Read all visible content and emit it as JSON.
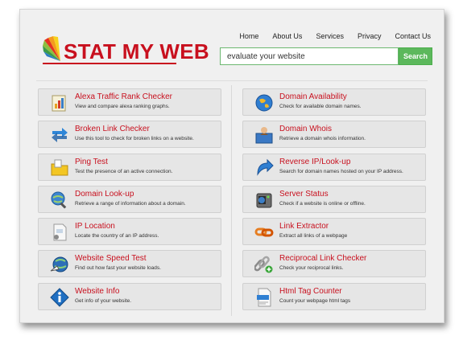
{
  "brand": {
    "name": "STAT MY WEB",
    "accent": "#c8101e"
  },
  "nav": [
    "Home",
    "About Us",
    "Services",
    "Privacy",
    "Contact Us"
  ],
  "search": {
    "value": "evaluate your website",
    "button": "Search",
    "button_color": "#5cb85c"
  },
  "tools_left": [
    {
      "title": "Alexa Traffic Rank Checker",
      "desc": "View and compare alexa ranking graphs.",
      "icon": "ranking-chart-icon"
    },
    {
      "title": "Broken Link Checker",
      "desc": "Use this tool to check for broken links on a website.",
      "icon": "broken-link-arrow-icon"
    },
    {
      "title": "Ping Test",
      "desc": "Test the presence of an active connection.",
      "icon": "folder-ping-icon"
    },
    {
      "title": "Domain Look-up",
      "desc": "Retrieve a range of information about a domain.",
      "icon": "globe-search-icon"
    },
    {
      "title": "IP Location",
      "desc": "Locate the country of an IP address.",
      "icon": "ip-document-icon"
    },
    {
      "title": "Website Speed Test",
      "desc": "Find out how fast your website loads.",
      "icon": "speed-globe-icon"
    },
    {
      "title": "Website Info",
      "desc": "Get info of your website.",
      "icon": "info-icon"
    }
  ],
  "tools_right": [
    {
      "title": "Domain Availability",
      "desc": "Check for available domain names.",
      "icon": "globe-icon"
    },
    {
      "title": "Domain Whois",
      "desc": "Retrieve a domain whois information.",
      "icon": "whois-person-icon"
    },
    {
      "title": "Reverse IP/Look-up",
      "desc": "Search for domain names hosted on your IP address.",
      "icon": "reverse-arrow-icon"
    },
    {
      "title": "Server Status",
      "desc": "Check if a website is online or offline.",
      "icon": "server-icon"
    },
    {
      "title": "Link Extractor",
      "desc": "Extract all links of a webpage",
      "icon": "chain-link-icon"
    },
    {
      "title": "Reciprocal Link Checker",
      "desc": "Check your reciprocal links.",
      "icon": "link-add-icon"
    },
    {
      "title": "Html Tag Counter",
      "desc": "Count your webpage html tags",
      "icon": "html-document-icon"
    }
  ]
}
